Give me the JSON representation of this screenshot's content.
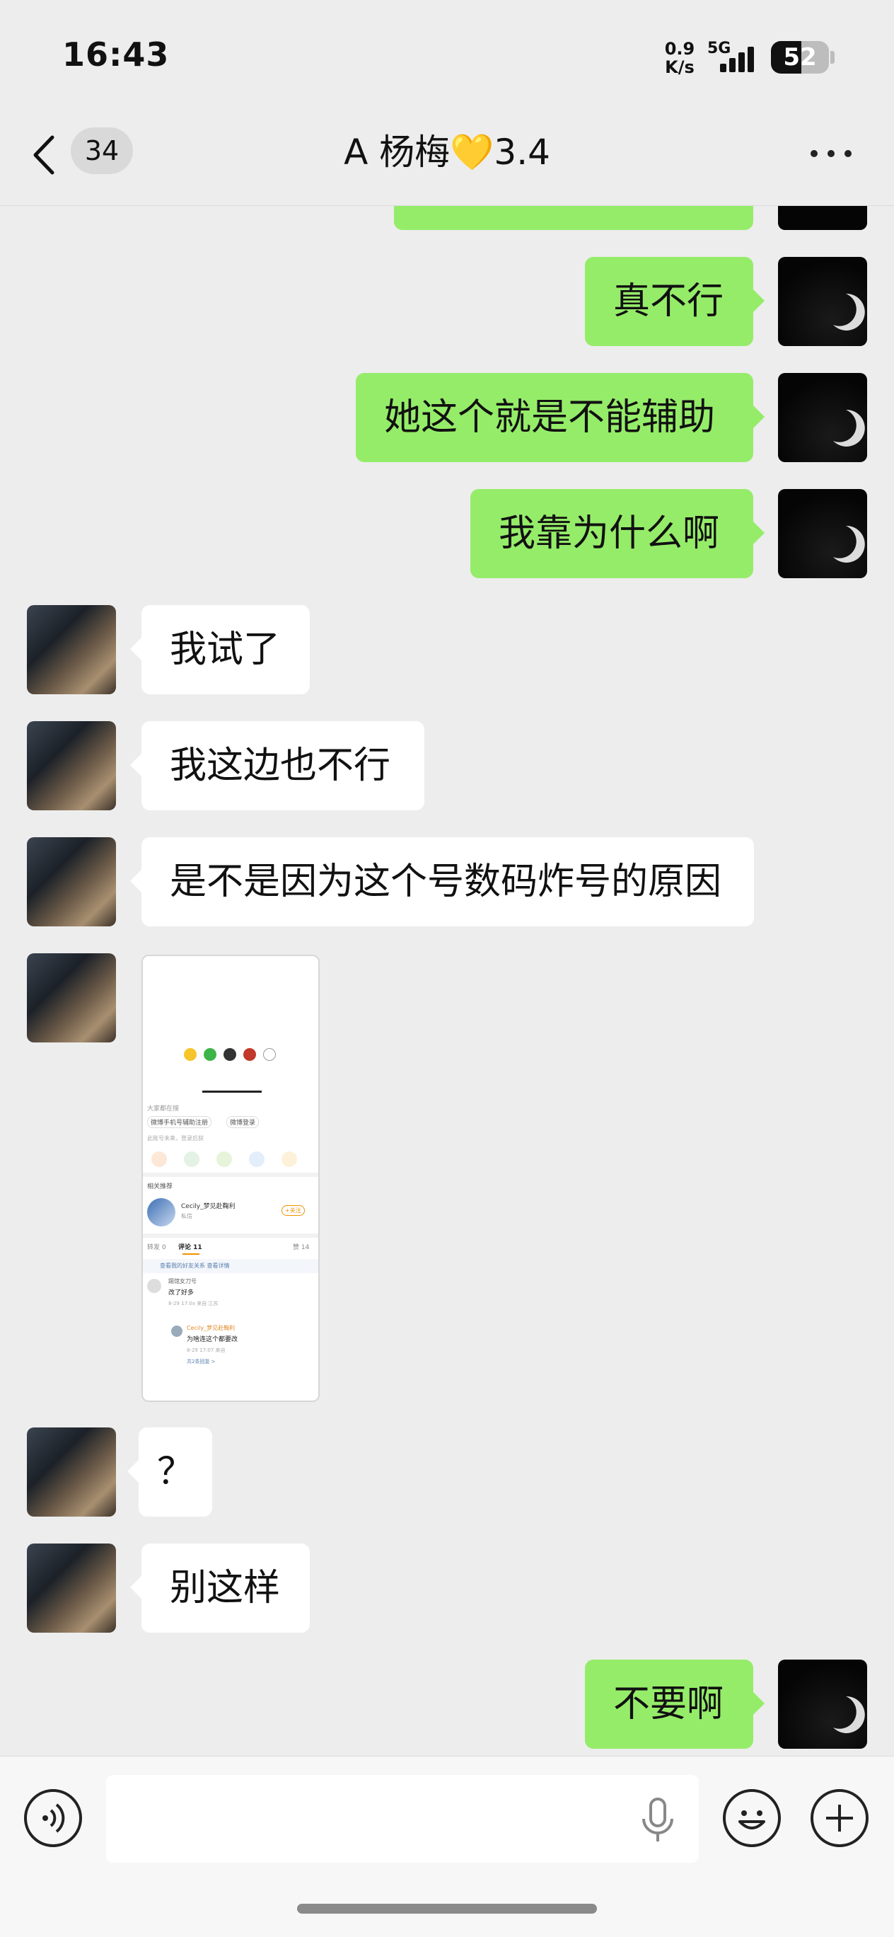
{
  "status_bar": {
    "time": "16:43",
    "net_speed_value": "0.9",
    "net_speed_unit": "K/s",
    "network_type": "5G",
    "battery": "52",
    "battery_level_percent": 52
  },
  "header": {
    "unread_count": "34",
    "title": "A 杨梅💛3.4"
  },
  "messages": [
    {
      "from": "me",
      "text": "真不行"
    },
    {
      "from": "me",
      "text": "她这个就是不能辅助"
    },
    {
      "from": "me",
      "text": "我靠为什么啊"
    },
    {
      "from": "her",
      "text": "我试了"
    },
    {
      "from": "her",
      "text": "我这边也不行"
    },
    {
      "from": "her",
      "text": "是不是因为这个号数码炸号的原因"
    },
    {
      "from": "her",
      "type": "image"
    },
    {
      "from": "her",
      "text": "？"
    },
    {
      "from": "her",
      "text": "别这样"
    },
    {
      "from": "me",
      "text": "不要啊"
    }
  ],
  "screenshot_thumb": {
    "tag1": "大家都在搜",
    "search1": "微博手机号辅助注册",
    "search2": "微博登录",
    "hint": "此账号未来，登录后获",
    "related": "相关推荐",
    "user_name": "Cecily_梦见赴鞠利",
    "user_sub": "私信",
    "follow": "+关注",
    "tabs": [
      "转发 0",
      "评论 11",
      "赞 14"
    ],
    "notice": "查看我的好友关系 查看详情",
    "commenter1": "踢馆女刀号",
    "comment1": "改了好多",
    "meta1": "8-29 17:0x 来自 江苏",
    "commenter2": "Cecily_梦见赴鞠利",
    "comment2": "为啥连这个都要改",
    "meta2": "8-29 17:07 来自",
    "more_replies": "共2条回复 >"
  },
  "input_bar": {
    "placeholder": ""
  }
}
